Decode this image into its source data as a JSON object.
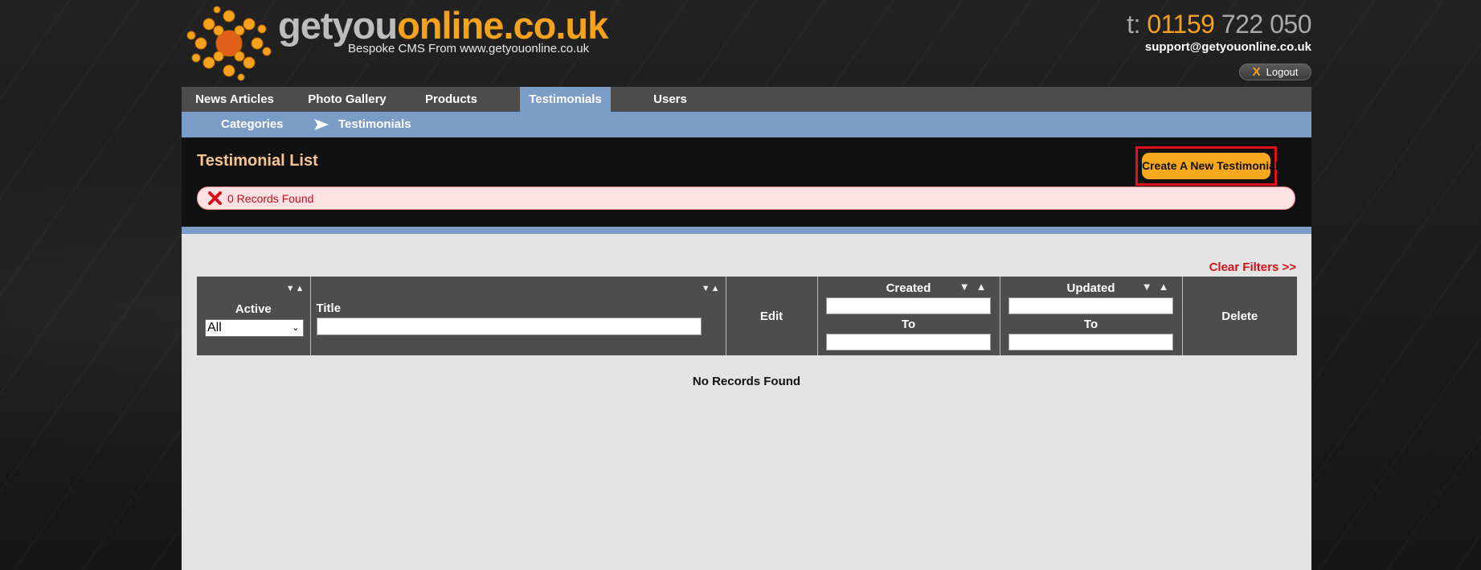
{
  "header": {
    "brand_part1": "getyou",
    "brand_part2": "online.co.uk",
    "tagline": "Bespoke CMS From www.getyouonline.co.uk",
    "phone_prefix": "t:",
    "phone_highlight": "01159",
    "phone_rest": "722 050",
    "email": "support@getyouonline.co.uk",
    "logout_icon_text": "X",
    "logout_label": "Logout"
  },
  "nav": {
    "items": [
      {
        "label": "News Articles"
      },
      {
        "label": "Photo Gallery"
      },
      {
        "label": "Products"
      },
      {
        "label": "Testimonials",
        "active": true
      },
      {
        "label": "Users"
      }
    ]
  },
  "subnav": {
    "items": [
      {
        "label": "Categories"
      },
      {
        "label": "Testimonials",
        "icon": "arrow-right-icon"
      }
    ]
  },
  "main": {
    "title": "Testimonial List",
    "create_button": "Create A New Testimonial",
    "alert_text": "0 Records Found",
    "clear_filters": "Clear Filters >>",
    "no_records": "No Records Found"
  },
  "table": {
    "sort_icons": "▼▲",
    "columns": {
      "active": "Active",
      "title": "Title",
      "edit": "Edit",
      "created": "Created",
      "updated": "Updated",
      "to": "To",
      "delete": "Delete"
    },
    "active_filter_value": "All"
  },
  "colors": {
    "accent_orange": "#f7a81c",
    "nav_blue": "#7c9cc8",
    "alert_red": "#c2121d",
    "highlight_border": "#e4101b"
  }
}
